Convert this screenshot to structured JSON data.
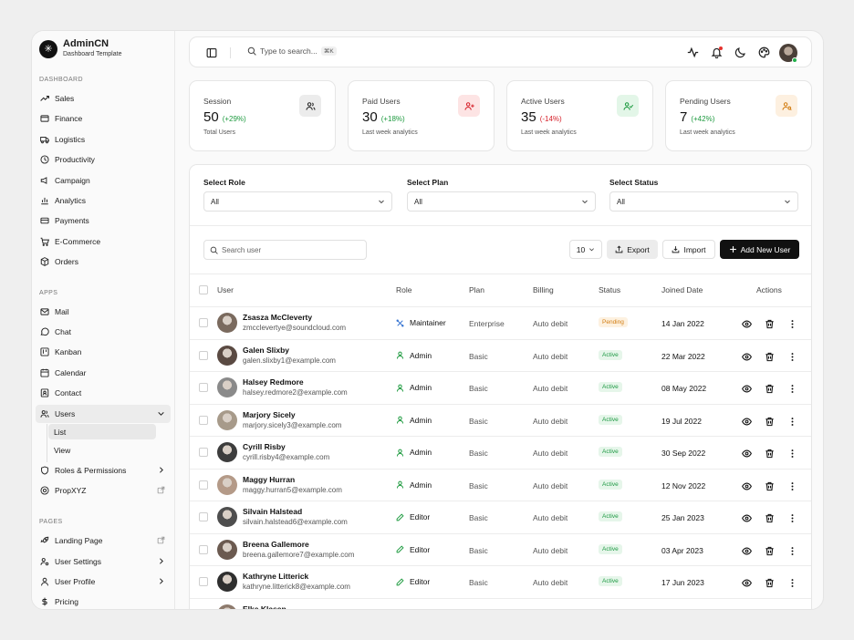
{
  "brand": {
    "name": "AdminCN",
    "subtitle": "Dashboard Template"
  },
  "sidebar": {
    "dashboard_label": "DASHBOARD",
    "dashboard_items": [
      "Sales",
      "Finance",
      "Logistics",
      "Productivity",
      "Campaign",
      "Analytics",
      "Payments",
      "E-Commerce",
      "Orders"
    ],
    "apps_label": "APPS",
    "apps_items": [
      "Mail",
      "Chat",
      "Kanban",
      "Calendar",
      "Contact",
      "Users"
    ],
    "users_sub": [
      "List",
      "View"
    ],
    "more_items": [
      "Roles & Permissions",
      "PropXYZ"
    ],
    "pages_label": "PAGES",
    "pages_items": [
      "Landing Page",
      "User Settings",
      "User Profile",
      "Pricing"
    ]
  },
  "topbar": {
    "search_placeholder": "Type to search...",
    "shortcut": "⌘K"
  },
  "stats": [
    {
      "label": "Session",
      "value": "50",
      "change": "(+29%)",
      "sub": "Total Users",
      "icon": "users-icon",
      "tone": "pos",
      "bg": "#ececec"
    },
    {
      "label": "Paid Users",
      "value": "30",
      "change": "(+18%)",
      "sub": "Last week analytics",
      "icon": "user-plus-icon",
      "tone": "pos",
      "bg": "#fde4e4"
    },
    {
      "label": "Active Users",
      "value": "35",
      "change": "(-14%)",
      "sub": "Last week analytics",
      "icon": "user-check-icon",
      "tone": "neg",
      "bg": "#e3f6e8"
    },
    {
      "label": "Pending Users",
      "value": "7",
      "change": "(+42%)",
      "sub": "Last week analytics",
      "icon": "user-search-icon",
      "tone": "pos",
      "bg": "#fdf0e0"
    }
  ],
  "filters": [
    {
      "label": "Select Role",
      "value": "All"
    },
    {
      "label": "Select Plan",
      "value": "All"
    },
    {
      "label": "Select Status",
      "value": "All"
    }
  ],
  "toolbar": {
    "search_placeholder": "Search user",
    "page_size": "10",
    "export_label": "Export",
    "import_label": "Import",
    "add_label": "Add New User"
  },
  "table": {
    "headers": [
      "User",
      "Role",
      "Plan",
      "Billing",
      "Status",
      "Joined Date",
      "Actions"
    ],
    "rows": [
      {
        "name": "Zsasza McCleverty",
        "email": "zmcclevertye@soundcloud.com",
        "role": "Maintainer",
        "plan": "Enterprise",
        "billing": "Auto debit",
        "status": "Pending",
        "joined": "14 Jan 2022"
      },
      {
        "name": "Galen Slixby",
        "email": "galen.slixby1@example.com",
        "role": "Admin",
        "plan": "Basic",
        "billing": "Auto debit",
        "status": "Active",
        "joined": "22 Mar 2022"
      },
      {
        "name": "Halsey Redmore",
        "email": "halsey.redmore2@example.com",
        "role": "Admin",
        "plan": "Basic",
        "billing": "Auto debit",
        "status": "Active",
        "joined": "08 May 2022"
      },
      {
        "name": "Marjory Sicely",
        "email": "marjory.sicely3@example.com",
        "role": "Admin",
        "plan": "Basic",
        "billing": "Auto debit",
        "status": "Active",
        "joined": "19 Jul 2022"
      },
      {
        "name": "Cyrill Risby",
        "email": "cyrill.risby4@example.com",
        "role": "Admin",
        "plan": "Basic",
        "billing": "Auto debit",
        "status": "Active",
        "joined": "30 Sep 2022"
      },
      {
        "name": "Maggy Hurran",
        "email": "maggy.hurran5@example.com",
        "role": "Admin",
        "plan": "Basic",
        "billing": "Auto debit",
        "status": "Active",
        "joined": "12 Nov 2022"
      },
      {
        "name": "Silvain Halstead",
        "email": "silvain.halstead6@example.com",
        "role": "Editor",
        "plan": "Basic",
        "billing": "Auto debit",
        "status": "Active",
        "joined": "25 Jan 2023"
      },
      {
        "name": "Breena Gallemore",
        "email": "breena.gallemore7@example.com",
        "role": "Editor",
        "plan": "Basic",
        "billing": "Auto debit",
        "status": "Active",
        "joined": "03 Apr 2023"
      },
      {
        "name": "Kathryne Litterick",
        "email": "kathryne.litterick8@example.com",
        "role": "Editor",
        "plan": "Basic",
        "billing": "Auto debit",
        "status": "Active",
        "joined": "17 Jun 2023"
      },
      {
        "name": "Elke Klasen",
        "email": "",
        "role": "",
        "plan": "",
        "billing": "",
        "status": "",
        "joined": ""
      }
    ]
  }
}
